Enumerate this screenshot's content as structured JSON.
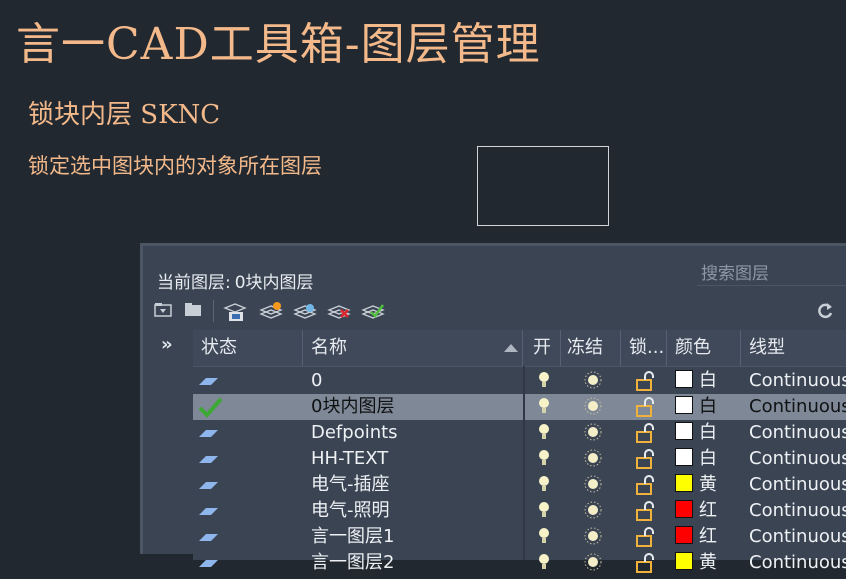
{
  "title": "言一CAD工具箱-图层管理",
  "subtitle": "锁块内层 SKNC",
  "description": "锁定选中图块内的对象所在图层",
  "panel": {
    "current_layer_label": "当前图层:",
    "current_layer_value": "0块内图层",
    "search_placeholder": "搜索图层",
    "sidebar_toggle": "»",
    "toolbar_icons": [
      "new-layer-filter-icon",
      "new-group-filter-icon",
      "layer-states-manager-icon",
      "new-layer-icon",
      "new-layer-vp-frozen-icon",
      "delete-layer-icon",
      "set-current-icon"
    ],
    "columns": {
      "status": "状态",
      "name": "名称",
      "on": "开",
      "freeze": "冻结",
      "lock": "锁...",
      "color": "颜色",
      "linetype": "线型"
    },
    "rows": [
      {
        "status": "layer-icon",
        "name": "0",
        "color_name": "白",
        "color_hex": "#ffffff",
        "linetype": "Continuous",
        "selected": false
      },
      {
        "status": "current-check-icon",
        "name": "0块内图层",
        "color_name": "白",
        "color_hex": "#ffffff",
        "linetype": "Continuous",
        "selected": true
      },
      {
        "status": "layer-icon",
        "name": "Defpoints",
        "color_name": "白",
        "color_hex": "#ffffff",
        "linetype": "Continuous",
        "selected": false
      },
      {
        "status": "layer-icon",
        "name": "HH-TEXT",
        "color_name": "白",
        "color_hex": "#ffffff",
        "linetype": "Continuous",
        "selected": false
      },
      {
        "status": "layer-icon",
        "name": "电气-插座",
        "color_name": "黄",
        "color_hex": "#ffff00",
        "linetype": "Continuous",
        "selected": false
      },
      {
        "status": "layer-icon",
        "name": "电气-照明",
        "color_name": "红",
        "color_hex": "#ff0000",
        "linetype": "Continuous",
        "selected": false
      },
      {
        "status": "layer-icon",
        "name": "言一图层1",
        "color_name": "红",
        "color_hex": "#ff0000",
        "linetype": "Continuous",
        "selected": false
      },
      {
        "status": "layer-icon",
        "name": "言一图层2",
        "color_name": "黄",
        "color_hex": "#ffff00",
        "linetype": "Continuous",
        "selected": false
      }
    ]
  }
}
